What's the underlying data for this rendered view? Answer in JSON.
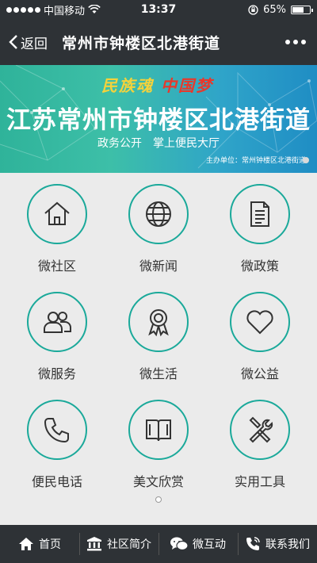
{
  "status": {
    "carrier": "中国移动",
    "time": "13:37",
    "battery": "65%",
    "battery_level": 0.65
  },
  "nav": {
    "back_label": "返回",
    "title": "常州市钟楼区北港街道"
  },
  "banner": {
    "slogan_a": "民族魂",
    "slogan_b": "中国梦",
    "title": "江苏常州市钟楼区北港街道",
    "sub_a": "政务公开",
    "sub_b": "掌上便民大厅",
    "sponsor": "主办单位：常州钟楼区北港街道"
  },
  "grid": [
    {
      "label": "微社区",
      "icon": "home-icon"
    },
    {
      "label": "微新闻",
      "icon": "globe-icon"
    },
    {
      "label": "微政策",
      "icon": "document-icon"
    },
    {
      "label": "微服务",
      "icon": "people-icon"
    },
    {
      "label": "微生活",
      "icon": "award-icon"
    },
    {
      "label": "微公益",
      "icon": "heart-icon"
    },
    {
      "label": "便民电话",
      "icon": "phone-icon"
    },
    {
      "label": "美文欣赏",
      "icon": "book-icon"
    },
    {
      "label": "实用工具",
      "icon": "tools-icon"
    }
  ],
  "tabs": [
    {
      "label": "首页",
      "icon": "home-icon"
    },
    {
      "label": "社区简介",
      "icon": "building-icon"
    },
    {
      "label": "微互动",
      "icon": "wechat-icon"
    },
    {
      "label": "联系我们",
      "icon": "phone-call-icon"
    }
  ],
  "colors": {
    "accent": "#1aa99a",
    "bar": "#2e3236"
  }
}
